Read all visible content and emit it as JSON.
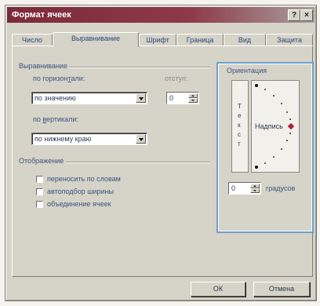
{
  "window": {
    "title": "Формат ячеек",
    "help_icon": "?",
    "close_icon": "×"
  },
  "tabs": [
    {
      "label": "Число"
    },
    {
      "label": "Выравнивание"
    },
    {
      "label": "Шрифт"
    },
    {
      "label": "Граница"
    },
    {
      "label": "Вид"
    },
    {
      "label": "Защита"
    }
  ],
  "alignment": {
    "group_label": "Выравнивание",
    "horizontal_label_pre": "по горизон",
    "horizontal_label_u": "т",
    "horizontal_label_post": "али:",
    "horizontal_value": "по значению",
    "indent_label": "отступ:",
    "indent_value": "0",
    "vertical_label_pre": "по ",
    "vertical_label_u": "в",
    "vertical_label_post": "ертикали:",
    "vertical_value": "по нижнему краю"
  },
  "display": {
    "group_label": "Отображение",
    "wrap_label": "переносить по словам",
    "autofit_label": "автоподбор ширины",
    "merge_label": "объединение ячеек"
  },
  "orientation": {
    "group_label": "Ориентация",
    "vertical_text": [
      "Т",
      "е",
      "к",
      "с",
      "т"
    ],
    "dial_label": "Надпись",
    "degrees_value": "0",
    "degrees_label": "градусов"
  },
  "buttons": {
    "ok": "ОК",
    "cancel": "Отмена"
  }
}
